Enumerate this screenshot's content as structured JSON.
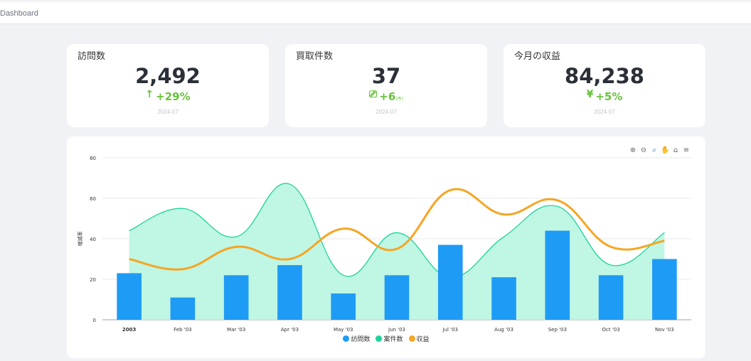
{
  "breadcrumb": "Dashboard",
  "cards": [
    {
      "title": "訪問数",
      "value": "2,492",
      "icon": "↑",
      "change": "+29%",
      "unit": "",
      "date": "2024-07"
    },
    {
      "title": "買取件数",
      "value": "37",
      "icon": "⎚",
      "change": "+6",
      "unit": "(件)",
      "date": "2024-07"
    },
    {
      "title": "今月の収益",
      "value": "84,238",
      "icon": "¥",
      "change": "+5%",
      "unit": "",
      "date": "2024-07"
    }
  ],
  "colors": {
    "accent_green": "#67c23a",
    "bar": "#1e9bf5",
    "area_line": "#1fd39a",
    "area_fill": "#bdf6e3",
    "revenue": "#f5a623"
  },
  "toolbox": [
    {
      "name": "zoom-in-icon",
      "glyph": "⊕"
    },
    {
      "name": "zoom-out-icon",
      "glyph": "⊖"
    },
    {
      "name": "magnify-icon",
      "glyph": "⌕"
    },
    {
      "name": "pan-hand-icon",
      "glyph": "✋"
    },
    {
      "name": "home-icon",
      "glyph": "⌂"
    },
    {
      "name": "menu-icon",
      "glyph": "≡"
    }
  ],
  "chart_data": {
    "type": "bar",
    "categories": [
      "2003",
      "Feb '03",
      "Mar '03",
      "Apr '03",
      "May '03",
      "Jun '03",
      "Jul '03",
      "Aug '03",
      "Sep '03",
      "Oct '03",
      "Nov '03"
    ],
    "ylabel": "増減率",
    "ylim": [
      0,
      80
    ],
    "yticks": [
      0,
      20,
      40,
      60,
      80
    ],
    "grid": true,
    "legend_position": "bottom",
    "series": [
      {
        "name": "訪問数",
        "type": "bar",
        "color": "#1e9bf5",
        "values": [
          23,
          11,
          22,
          27,
          13,
          22,
          37,
          21,
          44,
          22,
          30
        ]
      },
      {
        "name": "案件数",
        "type": "area",
        "color": "#1fd39a",
        "values": [
          44,
          55,
          41,
          67,
          22,
          43,
          21,
          41,
          56,
          27,
          43
        ]
      },
      {
        "name": "収益",
        "type": "line",
        "color": "#f5a623",
        "values": [
          30,
          25,
          36,
          30,
          45,
          35,
          64,
          52,
          59,
          36,
          39
        ]
      }
    ]
  }
}
